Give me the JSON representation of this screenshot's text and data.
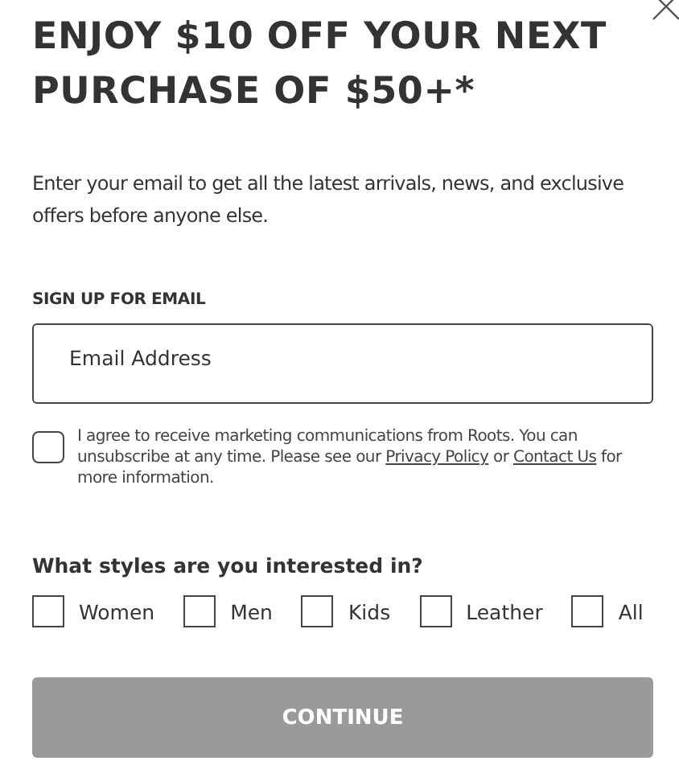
{
  "headline": "ENJOY $10 OFF YOUR NEXT PURCHASE OF $50+*",
  "intro": "Enter your email to get all the latest arrivals, news, and exclusive offers before anyone else.",
  "email_label": "SIGN UP FOR EMAIL",
  "email_field": {
    "placeholder": "Email Address"
  },
  "consent": {
    "checked": false,
    "parts": [
      {
        "kind": "text",
        "text": "I agree to receive marketing communications from Roots. You can unsubscribe at any time. Please see our "
      },
      {
        "kind": "link",
        "text": "Privacy Policy"
      },
      {
        "kind": "text",
        "text": " or "
      },
      {
        "kind": "link",
        "text": "Contact Us"
      },
      {
        "kind": "text",
        "text": " for more information."
      }
    ]
  },
  "styles_question": "What styles are you interested in?",
  "styles": [
    {
      "label": "Women",
      "checked": false
    },
    {
      "label": "Men",
      "checked": false
    },
    {
      "label": "Kids",
      "checked": false
    },
    {
      "label": "Leather",
      "checked": false
    },
    {
      "label": "All",
      "checked": false
    }
  ],
  "continue_button": {
    "label": "CONTINUE",
    "disabled": true
  }
}
